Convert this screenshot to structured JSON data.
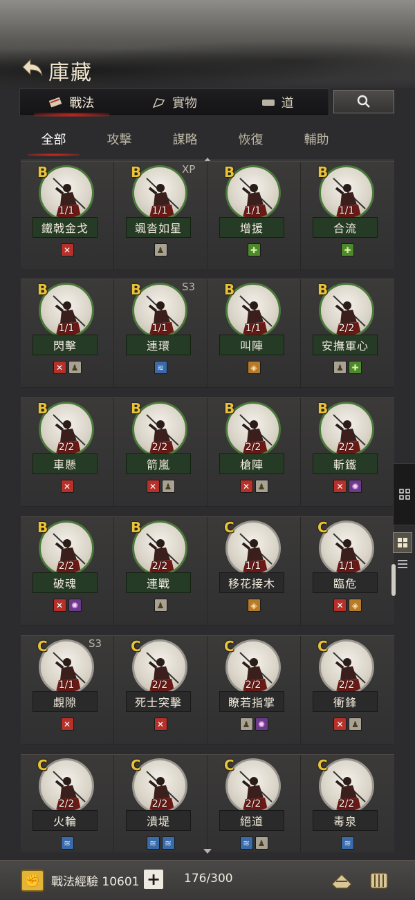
{
  "header": {
    "title": "庫藏",
    "back_icon": "back-arrow-icon"
  },
  "main_tabs": [
    {
      "label": "戰法",
      "icon": "scroll-icon",
      "active": true
    },
    {
      "label": "實物",
      "icon": "flag-icon",
      "active": false
    },
    {
      "label": "道",
      "icon": "item-icon",
      "active": false
    }
  ],
  "search": {
    "icon": "search-icon"
  },
  "sub_tabs": [
    {
      "label": "全部",
      "active": true
    },
    {
      "label": "攻擊",
      "active": false
    },
    {
      "label": "謀略",
      "active": false
    },
    {
      "label": "恢復",
      "active": false
    },
    {
      "label": "輔助",
      "active": false
    }
  ],
  "tactics": [
    {
      "grade": "B",
      "count": "1/1",
      "name": "鐵戟金戈",
      "tag": "",
      "traits": [
        "attack"
      ]
    },
    {
      "grade": "B",
      "count": "1/1",
      "name": "颯沓如星",
      "tag": "XP",
      "traits": [
        "aid"
      ]
    },
    {
      "grade": "B",
      "count": "1/1",
      "name": "增援",
      "tag": "",
      "traits": [
        "heal"
      ]
    },
    {
      "grade": "B",
      "count": "1/1",
      "name": "合流",
      "tag": "",
      "traits": [
        "heal"
      ]
    },
    {
      "grade": "B",
      "count": "1/1",
      "name": "閃擊",
      "tag": "",
      "traits": [
        "attack",
        "aid"
      ]
    },
    {
      "grade": "B",
      "count": "1/1",
      "name": "連環",
      "tag": "S3",
      "traits": [
        "wind"
      ]
    },
    {
      "grade": "B",
      "count": "1/1",
      "name": "叫陣",
      "tag": "",
      "traits": [
        "shield"
      ]
    },
    {
      "grade": "B",
      "count": "2/2",
      "name": "安撫軍心",
      "tag": "",
      "traits": [
        "aid",
        "heal"
      ]
    },
    {
      "grade": "B",
      "count": "2/2",
      "name": "車懸",
      "tag": "",
      "traits": [
        "attack"
      ]
    },
    {
      "grade": "B",
      "count": "2/2",
      "name": "箭嵐",
      "tag": "",
      "traits": [
        "attack",
        "aid"
      ]
    },
    {
      "grade": "B",
      "count": "2/2",
      "name": "槍陣",
      "tag": "",
      "traits": [
        "attack",
        "aid"
      ]
    },
    {
      "grade": "B",
      "count": "2/2",
      "name": "斬鐵",
      "tag": "",
      "traits": [
        "attack",
        "control"
      ]
    },
    {
      "grade": "B",
      "count": "2/2",
      "name": "破魂",
      "tag": "",
      "traits": [
        "attack",
        "control"
      ]
    },
    {
      "grade": "B",
      "count": "2/2",
      "name": "連戰",
      "tag": "",
      "traits": [
        "aid"
      ]
    },
    {
      "grade": "C",
      "count": "1/1",
      "name": "移花接木",
      "tag": "",
      "traits": [
        "shield"
      ]
    },
    {
      "grade": "C",
      "count": "1/1",
      "name": "臨危",
      "tag": "",
      "traits": [
        "attack",
        "shield"
      ]
    },
    {
      "grade": "C",
      "count": "1/1",
      "name": "覷隙",
      "tag": "S3",
      "traits": [
        "attack"
      ]
    },
    {
      "grade": "C",
      "count": "2/2",
      "name": "死士突擊",
      "tag": "",
      "traits": [
        "attack"
      ]
    },
    {
      "grade": "C",
      "count": "2/2",
      "name": "瞭若指掌",
      "tag": "",
      "traits": [
        "aid",
        "control"
      ]
    },
    {
      "grade": "C",
      "count": "2/2",
      "name": "衝鋒",
      "tag": "",
      "traits": [
        "attack",
        "aid"
      ]
    },
    {
      "grade": "C",
      "count": "2/2",
      "name": "火輪",
      "tag": "",
      "traits": [
        "wind"
      ]
    },
    {
      "grade": "C",
      "count": "2/2",
      "name": "潰堤",
      "tag": "",
      "traits": [
        "wind",
        "wind"
      ]
    },
    {
      "grade": "C",
      "count": "2/2",
      "name": "絕道",
      "tag": "",
      "traits": [
        "wind",
        "aid"
      ]
    },
    {
      "grade": "C",
      "count": "2/2",
      "name": "毒泉",
      "tag": "",
      "traits": [
        "wind"
      ]
    }
  ],
  "footer": {
    "exp_label": "戰法經驗 10601",
    "plus": "+",
    "capacity": "176/300"
  },
  "colors": {
    "grade_b_ring": "#4a7a3a",
    "grade_c_ring": "#9a9690",
    "accent_red": "#dc281e"
  }
}
